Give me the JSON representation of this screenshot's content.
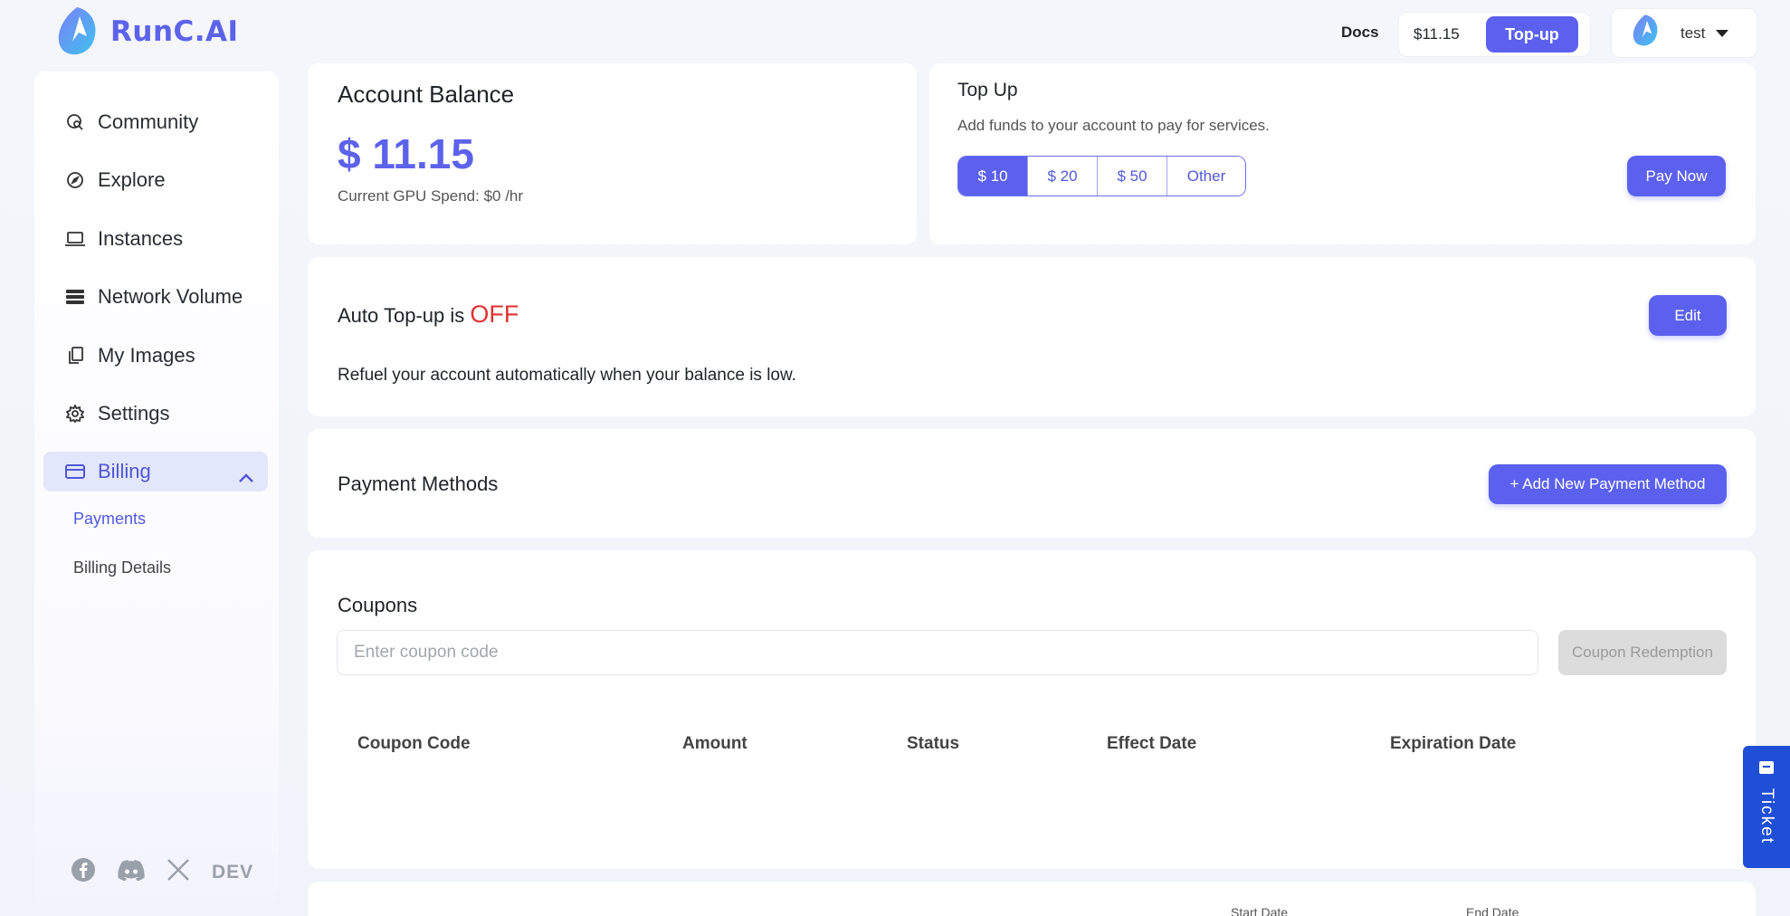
{
  "brand": {
    "name": "RunC.AI"
  },
  "header": {
    "docs_label": "Docs",
    "balance": "$11.15",
    "topup_label": "Top-up",
    "user_name": "test"
  },
  "sidebar": {
    "items": [
      {
        "label": "Community",
        "icon": "community-icon"
      },
      {
        "label": "Explore",
        "icon": "compass-icon"
      },
      {
        "label": "Instances",
        "icon": "laptop-icon"
      },
      {
        "label": "Network Volume",
        "icon": "storage-icon"
      },
      {
        "label": "My Images",
        "icon": "images-icon"
      },
      {
        "label": "Settings",
        "icon": "gear-icon"
      }
    ],
    "billing": {
      "label": "Billing",
      "expanded": true
    },
    "sub_items": [
      {
        "label": "Payments",
        "active": true
      },
      {
        "label": "Billing Details",
        "active": false
      }
    ],
    "social": [
      "facebook-icon",
      "discord-icon",
      "x-icon",
      "dev-icon"
    ],
    "dev_label": "DEV"
  },
  "account_balance": {
    "title": "Account Balance",
    "amount": "$ 11.15",
    "gpu_spend": "Current GPU Spend: $0 /hr"
  },
  "top_up": {
    "title": "Top Up",
    "description": "Add funds to your account to pay for services.",
    "options": [
      "$ 10",
      "$ 20",
      "$ 50",
      "Other"
    ],
    "selected_option": "$ 10",
    "pay_label": "Pay Now"
  },
  "auto_topup": {
    "title_prefix": "Auto Top-up is",
    "status": "OFF",
    "description": "Refuel your account automatically when your balance is low.",
    "edit_label": "Edit"
  },
  "payment_methods": {
    "title": "Payment Methods",
    "add_label": "+ Add New Payment Method"
  },
  "coupons": {
    "title": "Coupons",
    "placeholder": "Enter coupon code",
    "redeem_label": "Coupon Redemption",
    "columns": [
      "Coupon Code",
      "Amount",
      "Status",
      "Effect Date",
      "Expiration Date"
    ],
    "rows": []
  },
  "next_table": {
    "columns": [
      "Start Date",
      "End Date"
    ]
  },
  "ticket": {
    "label": "Ticket"
  },
  "colors": {
    "accent": "#5b61ee",
    "off": "#e03131",
    "ticket": "#1f4fd6"
  }
}
